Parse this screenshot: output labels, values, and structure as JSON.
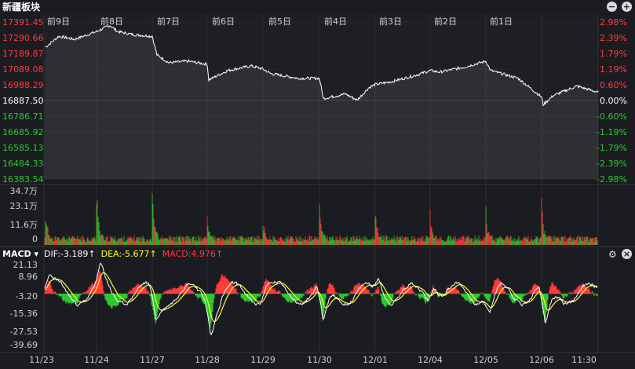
{
  "header": {
    "title": "新疆板块"
  },
  "icons": {
    "minimize": "minus-icon",
    "expand": "plus-icon",
    "settings": "gear-icon",
    "close": "close-icon"
  },
  "colors": {
    "up": "#ff3b3b",
    "down": "#2ec72e",
    "price_line": "#ffffff",
    "dea": "#ffff33",
    "dif": "#ffffff",
    "neutral": "#ffffff"
  },
  "price_panel": {
    "day_labels": [
      "前9日",
      "前8日",
      "前7日",
      "前6日",
      "前5日",
      "前4日",
      "前3日",
      "前2日",
      "前1日"
    ],
    "left_ticks": [
      "17391.45",
      "17290.66",
      "17189.87",
      "17089.08",
      "16988.29",
      "16887.50",
      "16786.71",
      "16685.92",
      "16585.13",
      "16484.33",
      "16383.54"
    ],
    "right_ticks": [
      "2.98%",
      "2.39%",
      "1.79%",
      "1.19%",
      "0.60%",
      "0.00%",
      "-0.60%",
      "-1.19%",
      "-1.79%",
      "-2.39%",
      "-2.98%"
    ]
  },
  "volume_panel": {
    "ticks": [
      "34.7万",
      "23.1万",
      "11.6万",
      "0"
    ]
  },
  "macd_panel": {
    "indicator": "MACD",
    "dif": "DIF:-3.189↑",
    "dea": "DEA:-5.677↑",
    "macd": "MACD:4.976↑",
    "ticks": [
      "21.13",
      "8.96",
      "-3.20",
      "-15.36",
      "-27.53",
      "-39.69"
    ]
  },
  "x_axis": {
    "labels": [
      "11/23",
      "11/24",
      "11/27",
      "11/28",
      "11/29",
      "11/30",
      "12/01",
      "12/04",
      "12/05",
      "12/06",
      "11:30"
    ]
  },
  "chart_data": [
    {
      "type": "line",
      "title": "新疆板块",
      "x": [
        "11/23",
        "11/24",
        "11/27",
        "11/28",
        "11/29",
        "11/30",
        "12/01",
        "12/04",
        "12/05",
        "12/06",
        "11:30"
      ],
      "y": [
        17290,
        17350,
        17200,
        17060,
        17090,
        16950,
        17000,
        17070,
        17080,
        16950,
        16900
      ],
      "ylim": [
        16383.54,
        17391.45
      ],
      "base_value": 16887.5,
      "grid": true
    },
    {
      "type": "bar",
      "title": "",
      "ylim": [
        0,
        347000
      ],
      "peaks": [
        220000,
        347000,
        140000,
        130000,
        175000,
        165000,
        135000,
        160000,
        140000,
        130000
      ]
    },
    {
      "type": "line",
      "title": "",
      "series": [
        {
          "name": "DIF",
          "last": -3.189
        },
        {
          "name": "DEA",
          "last": -5.677
        },
        {
          "name": "MACD",
          "last": 4.976
        }
      ],
      "ylim": [
        -39.69,
        21.13
      ]
    }
  ]
}
